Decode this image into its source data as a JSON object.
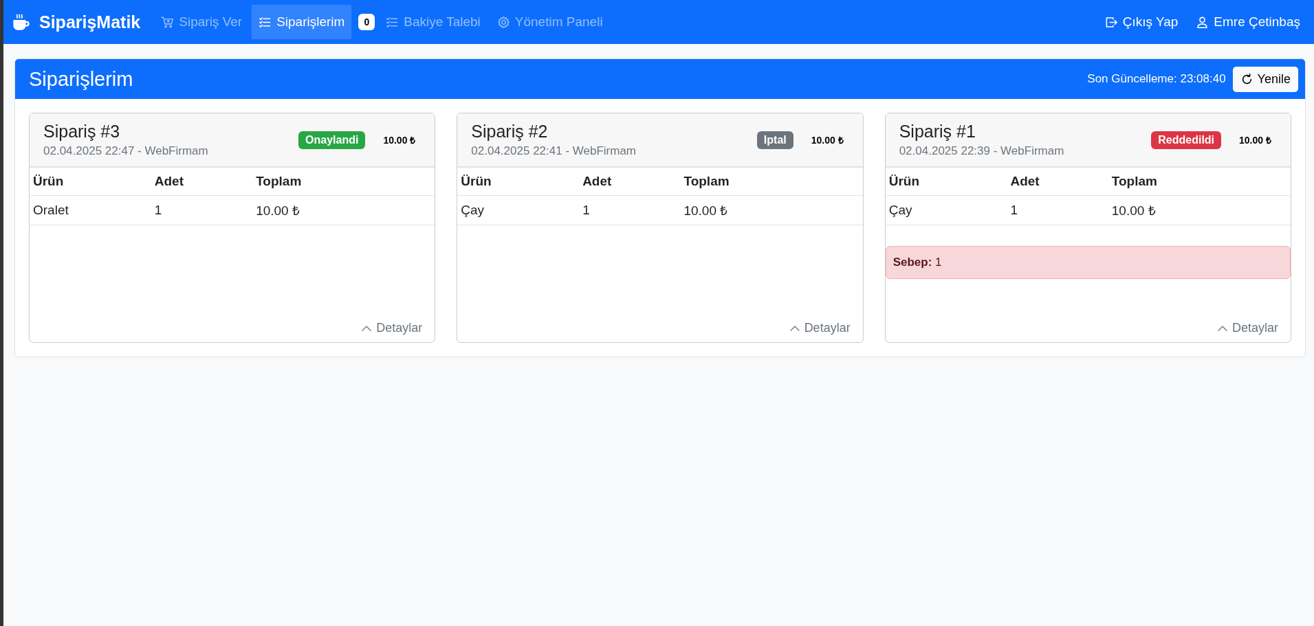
{
  "navbar": {
    "brand": "SiparişMatik",
    "items": [
      {
        "kind": "link",
        "label": "Sipariş Ver",
        "selected": false
      },
      {
        "kind": "link",
        "label": "Siparişlerim",
        "selected": true
      },
      {
        "kind": "counter",
        "label": "0"
      },
      {
        "kind": "link",
        "label": "Bakiye Talebi",
        "selected": false
      },
      {
        "kind": "link",
        "label": "Yönetim Paneli",
        "selected": false
      }
    ],
    "right": [
      {
        "kind": "logout",
        "label": "Çıkış Yap"
      },
      {
        "kind": "user",
        "label": "Emre Çetinbaş"
      }
    ]
  },
  "panel": {
    "title": "Siparişlerim",
    "last_update": "Son Güncelleme: 23:08:40",
    "refresh_button": "Yenile",
    "orders": [
      {
        "title": "Sipariş #3",
        "subtitle": "02.04.2025 22:47 - WebFirmam",
        "status": {
          "label": "Onaylandi",
          "color": "#28a745"
        },
        "total": "10.00 ₺",
        "columns": [
          "Ürün",
          "Adet",
          "Toplam"
        ],
        "rows": [
          [
            "Oralet",
            "1",
            "10.00 ₺"
          ]
        ],
        "details": "Detaylar"
      },
      {
        "title": "Sipariş #2",
        "subtitle": "02.04.2025 22:41 - WebFirmam",
        "status": {
          "label": "Iptal",
          "color": "#6c757d"
        },
        "total": "10.00 ₺",
        "columns": [
          "Ürün",
          "Adet",
          "Toplam"
        ],
        "rows": [
          [
            "Çay",
            "1",
            "10.00 ₺"
          ]
        ],
        "details": "Detaylar"
      },
      {
        "title": "Sipariş #1",
        "subtitle": "02.04.2025 22:39 - WebFirmam",
        "status": {
          "label": "Reddedildi",
          "color": "#dc3545"
        },
        "total": "10.00 ₺",
        "columns": [
          "Ürün",
          "Adet",
          "Toplam"
        ],
        "rows": [
          [
            "Çay",
            "1",
            "10.00 ₺"
          ]
        ],
        "reason": "**Sebep:** 1",
        "details": "Detaylar"
      }
    ]
  }
}
